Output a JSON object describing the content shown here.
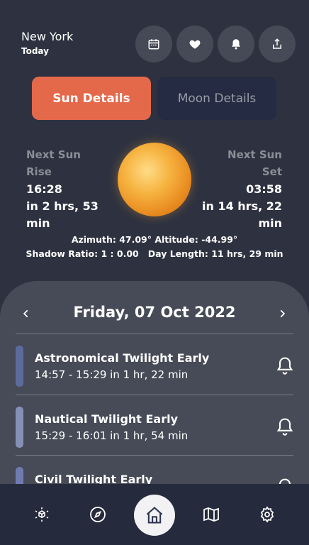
{
  "header": {
    "city": "New York",
    "subtitle": "Today",
    "actions": [
      {
        "icon": "calendar-icon"
      },
      {
        "icon": "heart-icon"
      },
      {
        "icon": "bell-icon"
      },
      {
        "icon": "share-icon"
      }
    ]
  },
  "tabs": {
    "sun": "Sun Details",
    "moon": "Moon Details",
    "active": "sun"
  },
  "sun": {
    "rise": {
      "label": "Next Sun\nRise",
      "label_line1": "Next Sun",
      "label_line2": "Rise",
      "time": "16:28",
      "relative": "in 2 hrs, 53 min"
    },
    "set": {
      "label_line1": "Next Sun",
      "label_line2": "Set",
      "time": "03:58",
      "relative": "in 14 hrs, 22 min"
    },
    "stats_line1": "Azimuth: 47.09° Altitude: -44.99°",
    "stats_line2": "Shadow Ratio: 1 : 0.00   Day Length: 11 hrs, 29 min"
  },
  "schedule": {
    "date": "Friday, 07 Oct 2022",
    "events": [
      {
        "name": "Astronomical Twilight Early",
        "time": "14:57 - 15:29 in 1 hr, 22 min",
        "color": "#5c6a9e"
      },
      {
        "name": "Nautical Twilight Early",
        "time": "15:29 - 16:01 in 1 hr, 54 min",
        "color": "#8590b5"
      },
      {
        "name": "Civil Twilight Early",
        "time": "",
        "color": "#6f7bb0"
      }
    ]
  },
  "nav": {
    "items": [
      "ar-cube-icon",
      "compass-icon",
      "home-icon",
      "map-icon",
      "settings-icon"
    ],
    "active": "home-icon"
  },
  "colors": {
    "background": "#2e3240",
    "accent": "#e4694b",
    "panel": "#474b57",
    "navbar": "#252a3d"
  }
}
